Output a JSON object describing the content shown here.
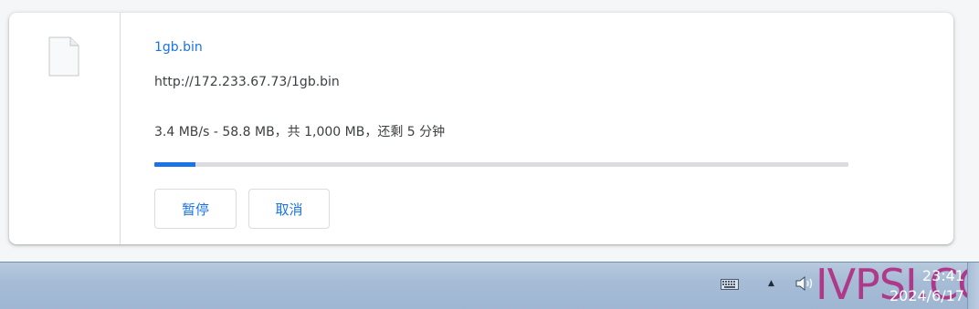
{
  "download": {
    "file_name": "1gb.bin",
    "url": "http://172.233.67.73/1gb.bin",
    "status": "3.4 MB/s - 58.8 MB，共 1,000 MB，还剩 5 分钟",
    "progress_fraction": 0.0588,
    "buttons": {
      "pause_label": "暂停",
      "cancel_label": "取消"
    },
    "colors": {
      "accent": "#1a73e8",
      "track": "#dadce0",
      "text": "#3c4043"
    }
  },
  "taskbar": {
    "tray_icons": [
      "keyboard-icon",
      "chevron-up-icon",
      "speaker-icon"
    ],
    "clock_time": "23:41",
    "clock_date": "2024/6/17",
    "watermark": "IVPSI.COM"
  }
}
